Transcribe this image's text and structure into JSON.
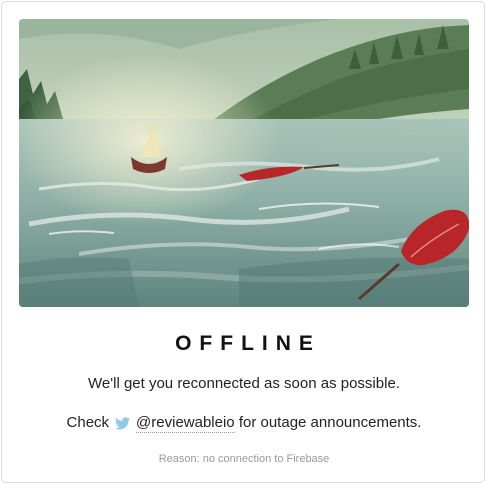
{
  "status": {
    "title": "OFFLINE",
    "message": "We'll get you reconnected as soon as possible.",
    "check_prefix": "Check",
    "twitter_handle": "@reviewableio",
    "check_suffix": "for outage announcements.",
    "reason": "Reason: no connection to Firebase"
  },
  "illustration": {
    "subject": "watercolor painting of a figure in a boat on a river with floating paddle"
  },
  "colors": {
    "twitter_blue": "#8fc9ea",
    "paddle_red": "#b8262a"
  }
}
